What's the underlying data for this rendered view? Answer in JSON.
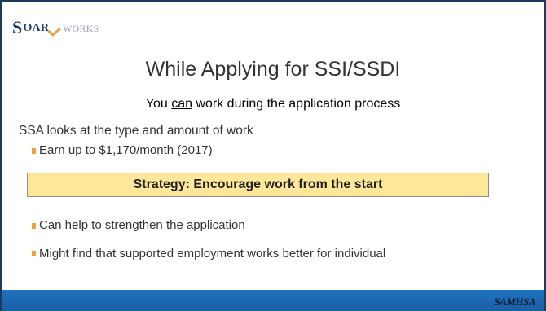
{
  "logo": {
    "s": "S",
    "oar": "OAR",
    "works": "WORKS"
  },
  "title": "While Applying for SSI/SSDI",
  "subtitle": {
    "pre": "You ",
    "emph": "can",
    "post": " work during the application process"
  },
  "main_text": "SSA looks at the type and amount of work",
  "bullet_earn": "Earn up to $1,170/month (2017)",
  "strategy": "Strategy: Encourage work from the start",
  "bullet_help": "Can help to strengthen the application",
  "bullet_supported": "Might find that supported employment works better for individual",
  "footer_logo": "SAMHSA",
  "colors": {
    "accent": "#f0a13b",
    "banner": "#ffe79a",
    "footer": "#1f73c0",
    "brand": "#1b3a5c"
  }
}
